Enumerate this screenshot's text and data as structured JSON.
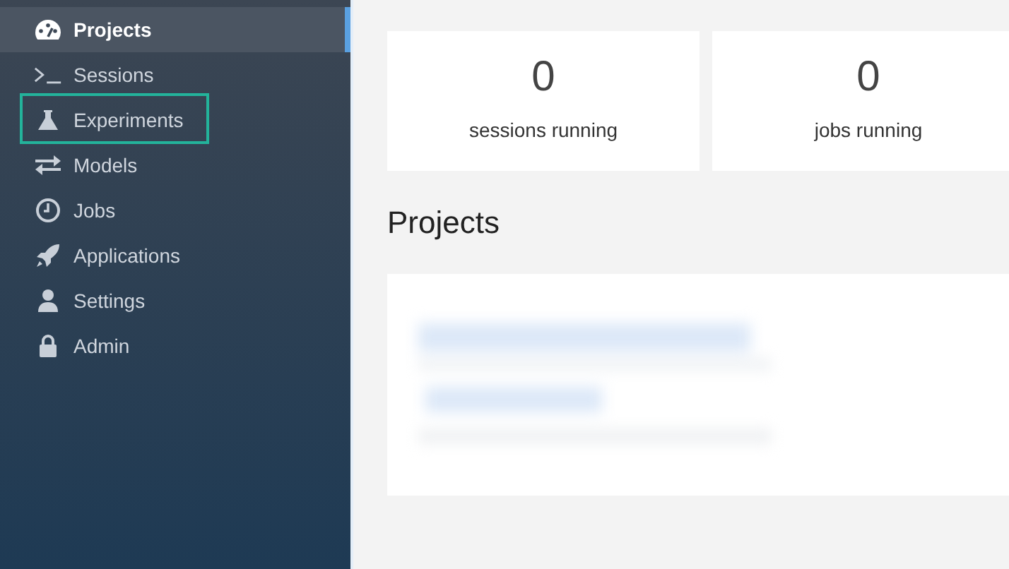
{
  "sidebar": {
    "items": [
      {
        "label": "Projects",
        "selected": true,
        "highlighted": false
      },
      {
        "label": "Sessions",
        "selected": false,
        "highlighted": false
      },
      {
        "label": "Experiments",
        "selected": false,
        "highlighted": true
      },
      {
        "label": "Models",
        "selected": false,
        "highlighted": false
      },
      {
        "label": "Jobs",
        "selected": false,
        "highlighted": false
      },
      {
        "label": "Applications",
        "selected": false,
        "highlighted": false
      },
      {
        "label": "Settings",
        "selected": false,
        "highlighted": false
      },
      {
        "label": "Admin",
        "selected": false,
        "highlighted": false
      }
    ]
  },
  "stats": [
    {
      "count": "0",
      "label": "sessions running"
    },
    {
      "count": "0",
      "label": "jobs running"
    }
  ],
  "projects": {
    "title": "Projects"
  }
}
